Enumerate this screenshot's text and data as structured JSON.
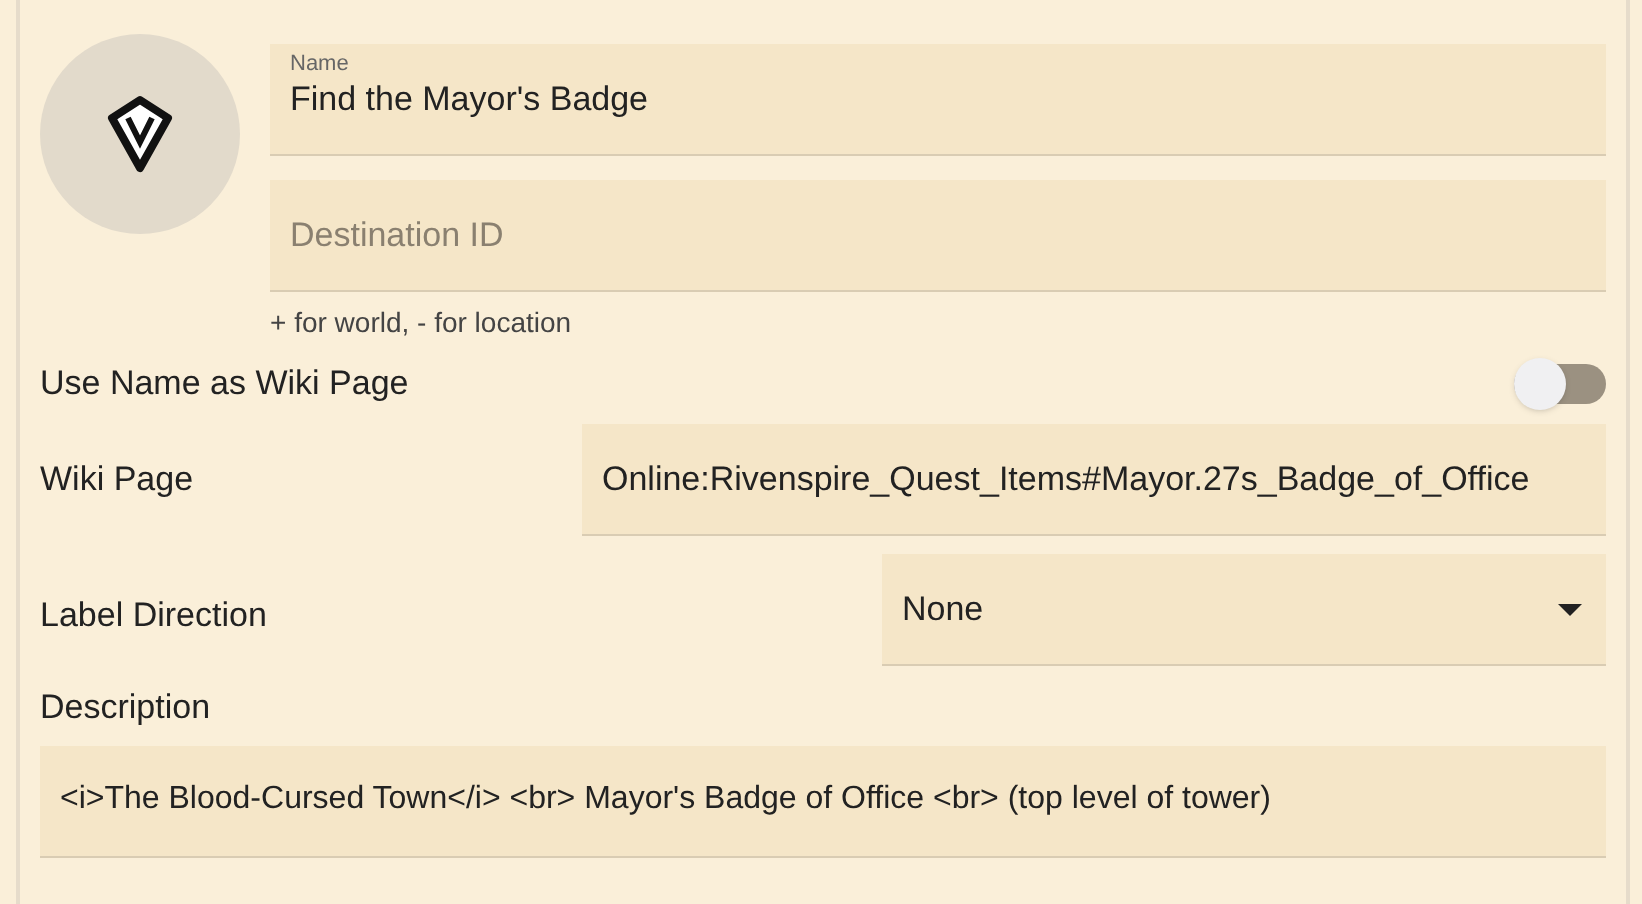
{
  "name_field": {
    "label": "Name",
    "value": "Find the Mayor's Badge"
  },
  "destination_field": {
    "placeholder": "Destination ID",
    "helper": "+ for world, - for location"
  },
  "use_name_toggle": {
    "label": "Use Name as Wiki Page",
    "on": false
  },
  "wiki_page": {
    "label": "Wiki Page",
    "value": "Online:Rivenspire_Quest_Items#Mayor.27s_Badge_of_Office"
  },
  "label_direction": {
    "label": "Label Direction",
    "value": "None"
  },
  "description": {
    "label": "Description",
    "value": "<i>The Blood-Cursed Town</i> <br> Mayor's Badge of Office <br> (top level of tower)"
  }
}
